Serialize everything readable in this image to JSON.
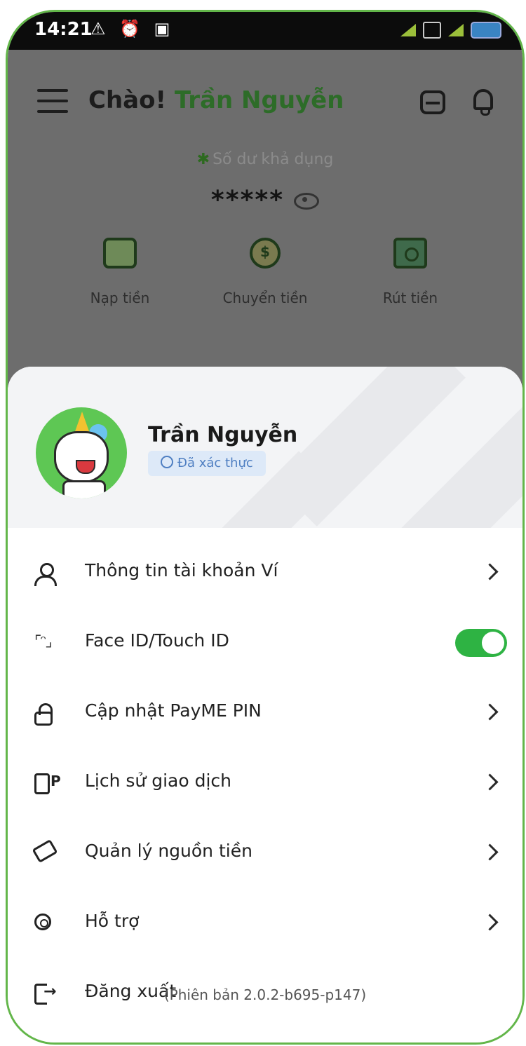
{
  "status_bar": {
    "time": "14:21",
    "left_icons": "⚠ ⏰ ▣"
  },
  "header": {
    "greeting": "Chào!",
    "user_name": "Trần Nguyễn"
  },
  "balance": {
    "label": "Số dư khả dụng",
    "value": "*****"
  },
  "actions": [
    {
      "label": "Nạp tiền",
      "icon": "wallet-icon"
    },
    {
      "label": "Chuyển tiền",
      "icon": "transfer-icon"
    },
    {
      "label": "Rút tiền",
      "icon": "withdraw-icon"
    }
  ],
  "profile": {
    "name": "Trần Nguyễn",
    "badge": "Đã xác thực"
  },
  "menu": [
    {
      "label": "Thông tin tài khoản Ví",
      "icon": "user-icon"
    },
    {
      "label": "Face ID/Touch ID",
      "icon": "face-id-icon",
      "toggle_on": true
    },
    {
      "label": "Cập nhật PayME PIN",
      "icon": "lock-icon"
    },
    {
      "label": "Lịch sử giao dịch",
      "icon": "history-icon"
    },
    {
      "label": "Quản lý nguồn tiền",
      "icon": "money-source-icon"
    },
    {
      "label": "Hỗ trợ",
      "icon": "support-icon"
    },
    {
      "label": "Đăng xuất",
      "icon": "logout-icon"
    }
  ],
  "version": "(Phiên bản 2.0.2-b695-p147)",
  "colors": {
    "accent_green": "#2eb343",
    "frame_green": "#63b64a",
    "badge_blue": "#dde9f8"
  }
}
